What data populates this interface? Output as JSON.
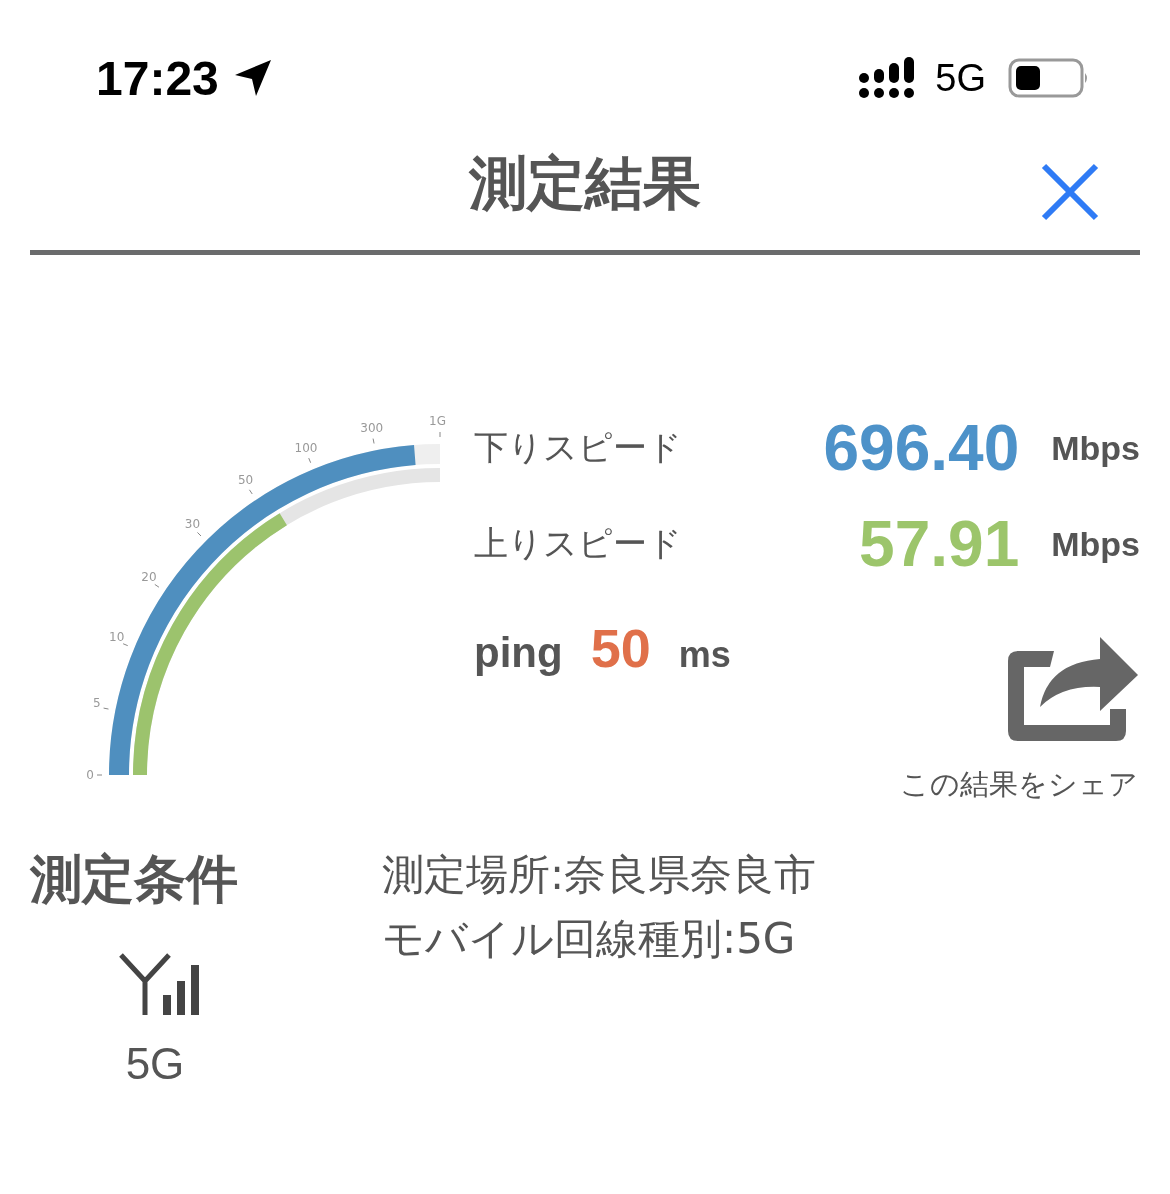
{
  "status_bar": {
    "time": "17:23",
    "network": "5G"
  },
  "header": {
    "title": "測定結果"
  },
  "gauge": {
    "ticks": [
      "0",
      "5",
      "10",
      "20",
      "30",
      "50",
      "100",
      "300",
      "1G"
    ]
  },
  "results": [
    {
      "kind": "download",
      "label": "下りスピード",
      "value": "696.40",
      "unit": "Mbps"
    },
    {
      "kind": "upload",
      "label": "上りスピード",
      "value": "57.91",
      "unit": "Mbps"
    }
  ],
  "ping": {
    "label": "ping",
    "value": "50",
    "unit": "ms"
  },
  "share": {
    "label": "この結果をシェア"
  },
  "conditions": {
    "title": "測定条件",
    "network": "5G",
    "details": [
      "測定場所:奈良県奈良市",
      "モバイル回線種別:5G"
    ]
  }
}
